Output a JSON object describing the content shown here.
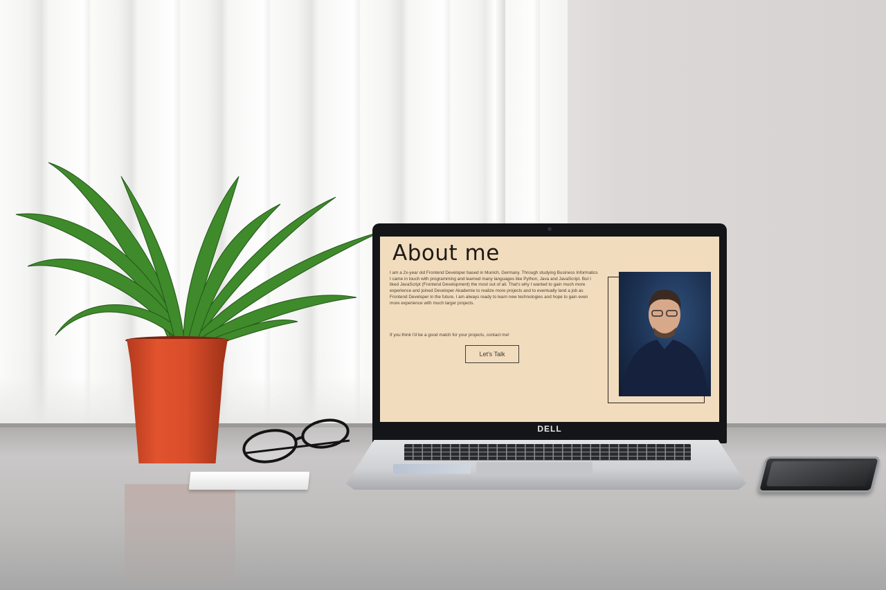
{
  "scene": {
    "laptop_brand": "DELL"
  },
  "about_page": {
    "title": "About me",
    "body": "I am a 2x-year old Frontend Developer based in Munich, Germany. Through studying Business Informatics I came in touch with programming and learned many languages like Python, Java and JavaScript. But I liked JavaScript (Frontend Development) the most out of all. That's why I wanted to gain much more experience and joined Developer Akademie to realize more projects and to eventually land a job as Frontend Developer in the future. I am always ready to learn new technologies and hope to gain even more experience with much larger projects.",
    "cta_text": "If you think I'd be a good match for your projects, contact me!",
    "button_label": "Let's Talk"
  },
  "colors": {
    "page_background": "#f1dcbe",
    "text": "#1f1a16",
    "photo_background": "#1a2d4c"
  },
  "icons": [
    "portrait-photo",
    "plant-decoration",
    "glasses-decoration",
    "smartphone-decoration"
  ]
}
